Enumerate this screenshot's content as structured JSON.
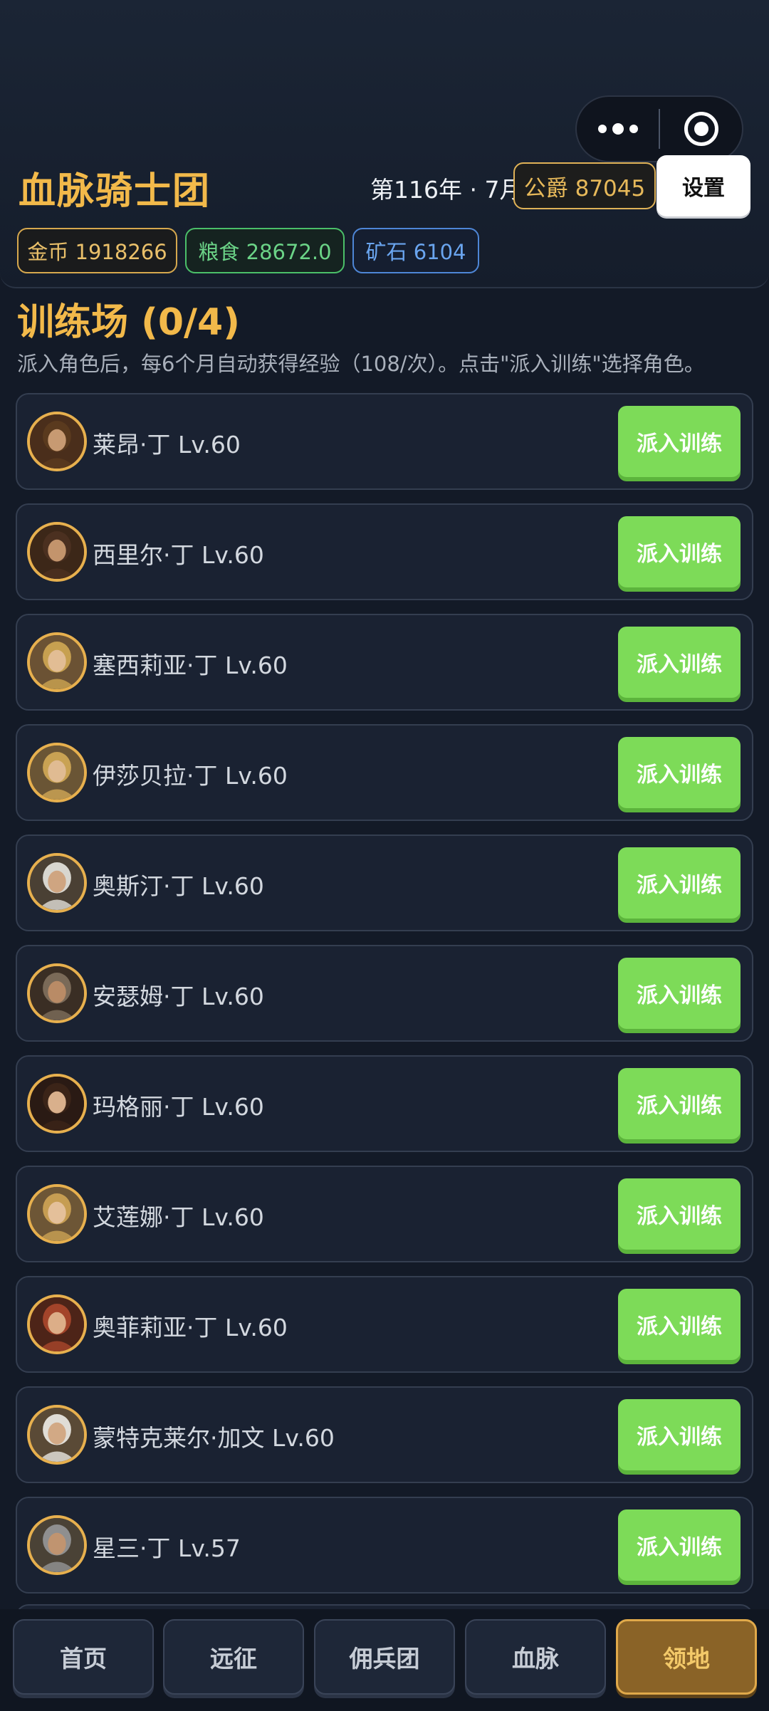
{
  "header": {
    "title": "血脉骑士团",
    "date": "第116年 · 7月",
    "rank": "公爵 87045",
    "settings_label": "设置",
    "capsule": {
      "more_icon": "more-dots-icon",
      "close_icon": "target-circle-icon"
    }
  },
  "resources": {
    "gold": "金币 1918266",
    "food": "粮食 28672.0",
    "ore": "矿石 6104"
  },
  "training": {
    "title": "训练场 (0/4)",
    "description": "派入角色后，每6个月自动获得经验（108/次）。点击\"派入训练\"选择角色。",
    "button_label": "派入训练",
    "characters": [
      {
        "name": "莱昂·丁 Lv.60",
        "hair": "#5a3a1e",
        "skin": "#c79a72",
        "bg": "#4a2e1b"
      },
      {
        "name": "西里尔·丁 Lv.60",
        "hair": "#4b3020",
        "skin": "#c3946c",
        "bg": "#3c2718"
      },
      {
        "name": "塞西莉亚·丁 Lv.60",
        "hair": "#c7a050",
        "skin": "#e2bd94",
        "bg": "#6b5234"
      },
      {
        "name": "伊莎贝拉·丁 Lv.60",
        "hair": "#c9a253",
        "skin": "#e0bb92",
        "bg": "#6a5535"
      },
      {
        "name": "奥斯汀·丁 Lv.60",
        "hair": "#d8d6cf",
        "skin": "#cfa581",
        "bg": "#4a4034"
      },
      {
        "name": "安瑟姆·丁 Lv.60",
        "hair": "#7a6a58",
        "skin": "#b98b66",
        "bg": "#3a2e24"
      },
      {
        "name": "玛格丽·丁 Lv.60",
        "hair": "#3b2418",
        "skin": "#d9b08c",
        "bg": "#2a1a14"
      },
      {
        "name": "艾莲娜·丁 Lv.60",
        "hair": "#c69d52",
        "skin": "#e4c09a",
        "bg": "#6d5636"
      },
      {
        "name": "奥菲莉亚·丁 Lv.60",
        "hair": "#a3442a",
        "skin": "#dcae88",
        "bg": "#4d2418"
      },
      {
        "name": "蒙特克莱尔·加文 Lv.60",
        "hair": "#e0ddd6",
        "skin": "#d2a985",
        "bg": "#5a4a36"
      },
      {
        "name": "星三·丁 Lv.57",
        "hair": "#8f8f8f",
        "skin": "#c09470",
        "bg": "#4a4236"
      }
    ]
  },
  "nav": {
    "items": [
      "首页",
      "远征",
      "佣兵团",
      "血脉",
      "领地"
    ],
    "active_index": 4
  }
}
